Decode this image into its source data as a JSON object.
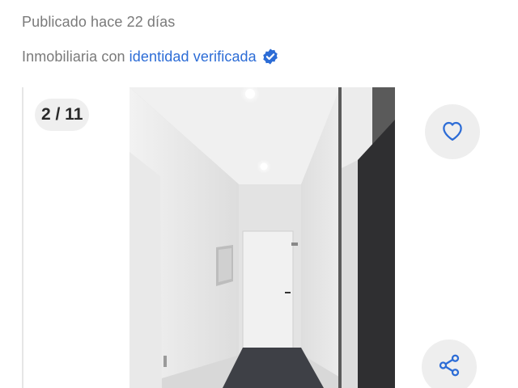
{
  "listing": {
    "published": "Publicado hace 22 días",
    "agency_prefix": "Inmobiliaria con",
    "agency_link": "identidad verificada",
    "verified_icon": "verified-badge-icon"
  },
  "gallery": {
    "counter": "2 / 11",
    "favorite_icon": "heart-icon",
    "share_icon": "share-icon"
  },
  "colors": {
    "accent": "#2c6cd6",
    "muted_text": "#7a7a7a",
    "button_bg": "#eeeeee"
  }
}
